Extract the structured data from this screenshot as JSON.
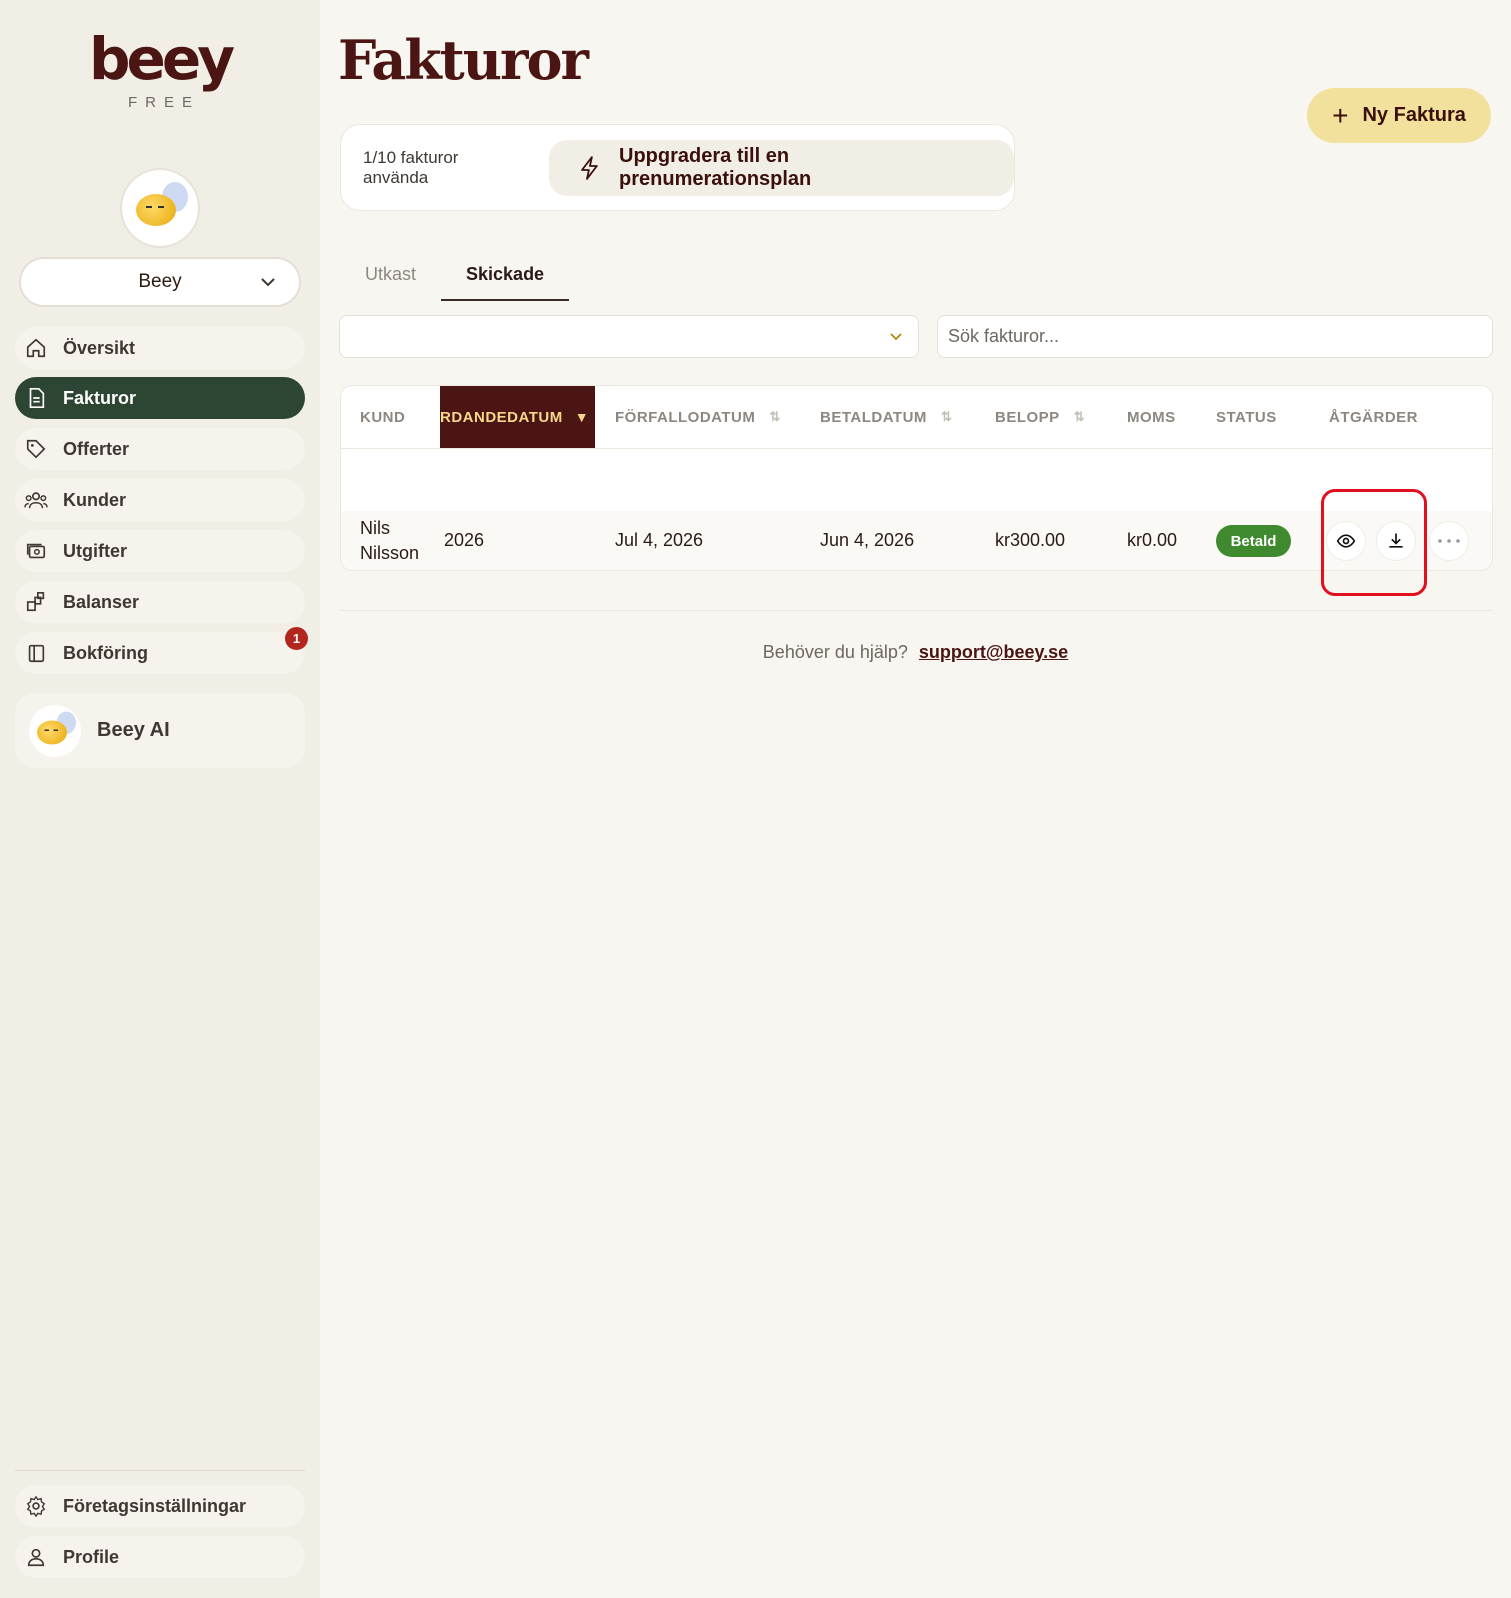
{
  "brand": {
    "logo_text": "beey",
    "plan": "FREE"
  },
  "sidebar": {
    "company": "Beey",
    "items": [
      {
        "label": "Översikt",
        "icon": "home-icon"
      },
      {
        "label": "Fakturor",
        "icon": "document-icon",
        "active": true
      },
      {
        "label": "Offerter",
        "icon": "tag-icon"
      },
      {
        "label": "Kunder",
        "icon": "users-icon"
      },
      {
        "label": "Utgifter",
        "icon": "money-icon"
      },
      {
        "label": "Balanser",
        "icon": "blocks-icon"
      },
      {
        "label": "Bokföring",
        "icon": "book-icon",
        "badge": "1"
      }
    ],
    "ai_label": "Beey AI",
    "footer_items": [
      {
        "label": "Företagsinställningar",
        "icon": "gear-icon"
      },
      {
        "label": "Profile",
        "icon": "user-icon"
      }
    ]
  },
  "main": {
    "title": "Fakturor",
    "new_button": "Ny Faktura",
    "usage_text": "1/10 fakturor använda",
    "upgrade_button": "Uppgradera till en prenumerationsplan",
    "tabs": [
      {
        "label": "Utkast"
      },
      {
        "label": "Skickade",
        "active": true
      }
    ],
    "search_placeholder": "Sök fakturor...",
    "table": {
      "columns": [
        "KUND",
        "RDANDEDATUM",
        "FÖRFALLODATUM",
        "BETALDATUM",
        "BELOPP",
        "MOMS",
        "STATUS",
        "ÅTGÄRDER"
      ],
      "sort_arrow": "▼",
      "rows": [
        {
          "kund_first": "Nils",
          "kund_last": "Nilsson",
          "date": "2026",
          "due": "Jul 4, 2026",
          "paid": "Jun 4, 2026",
          "amount": "kr300.00",
          "vat": "kr0.00",
          "status": "Betald"
        }
      ]
    },
    "help_text": "Behöver du hjälp?",
    "help_link": "support@beey.se"
  },
  "colors": {
    "brand_maroon": "#4a1512",
    "nav_active": "#2d4634",
    "accent_yellow": "#f2e19c",
    "status_paid": "#3f8a2f",
    "badge_red": "#b3261e",
    "highlight_red": "#e0101e"
  }
}
